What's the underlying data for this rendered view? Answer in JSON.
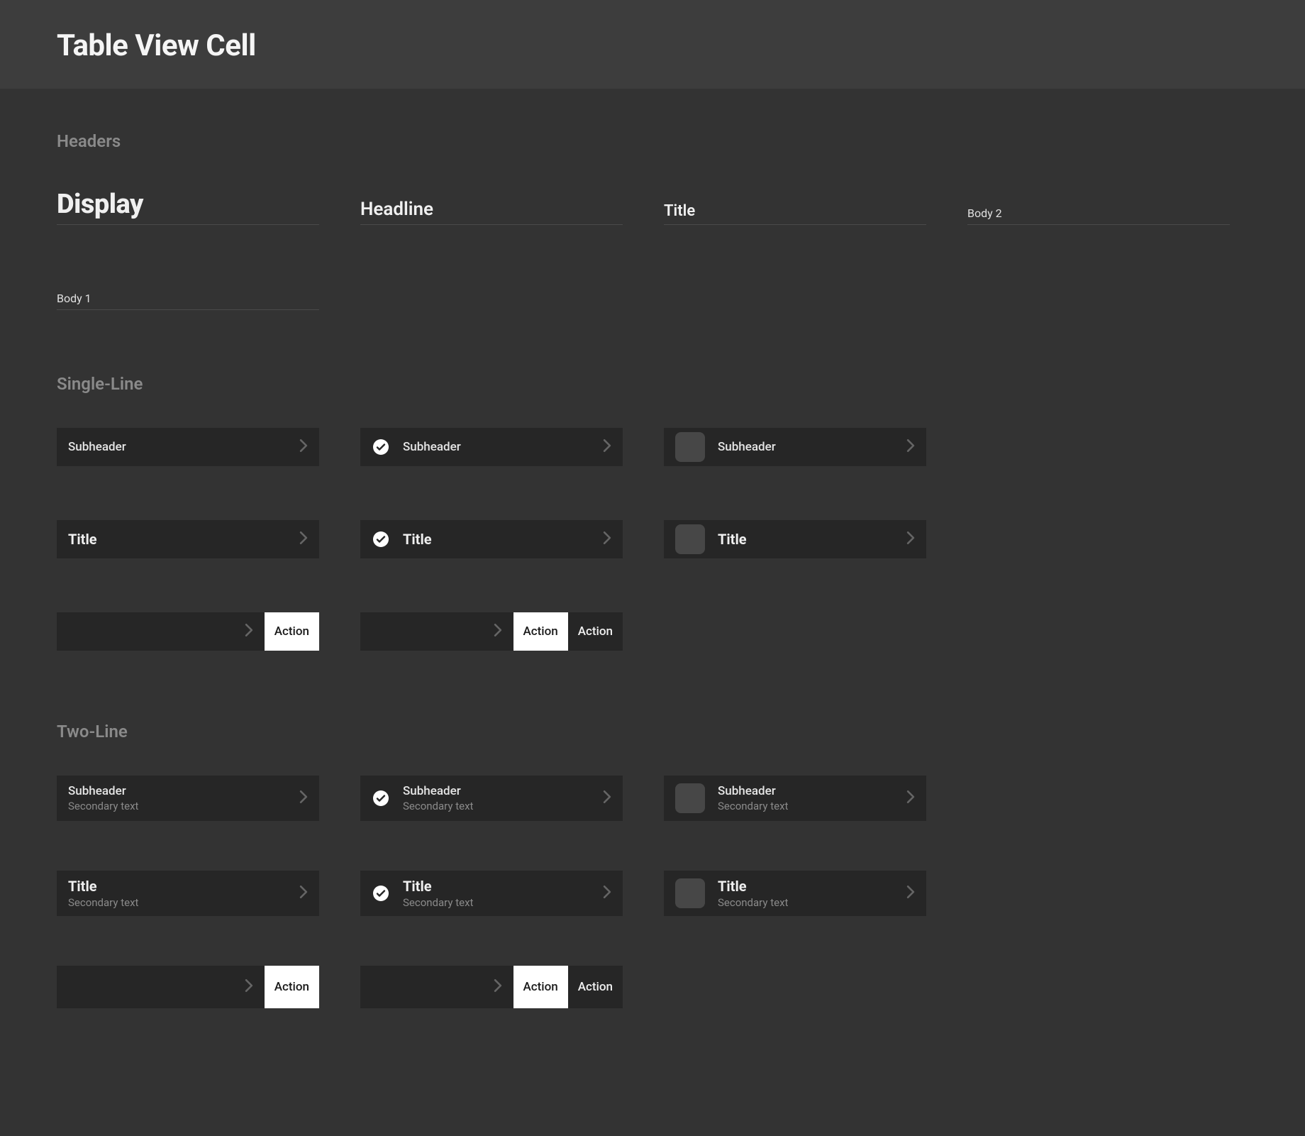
{
  "page_title": "Table View Cell",
  "sections": {
    "headers": "Headers",
    "single_line": "Single-Line",
    "two_line": "Two-Line"
  },
  "headers": {
    "display": "Display",
    "headline": "Headline",
    "title": "Title",
    "body2": "Body 2",
    "body1": "Body 1"
  },
  "cell": {
    "subheader": "Subheader",
    "title": "Title",
    "secondary": "Secondary text",
    "action": "Action"
  }
}
